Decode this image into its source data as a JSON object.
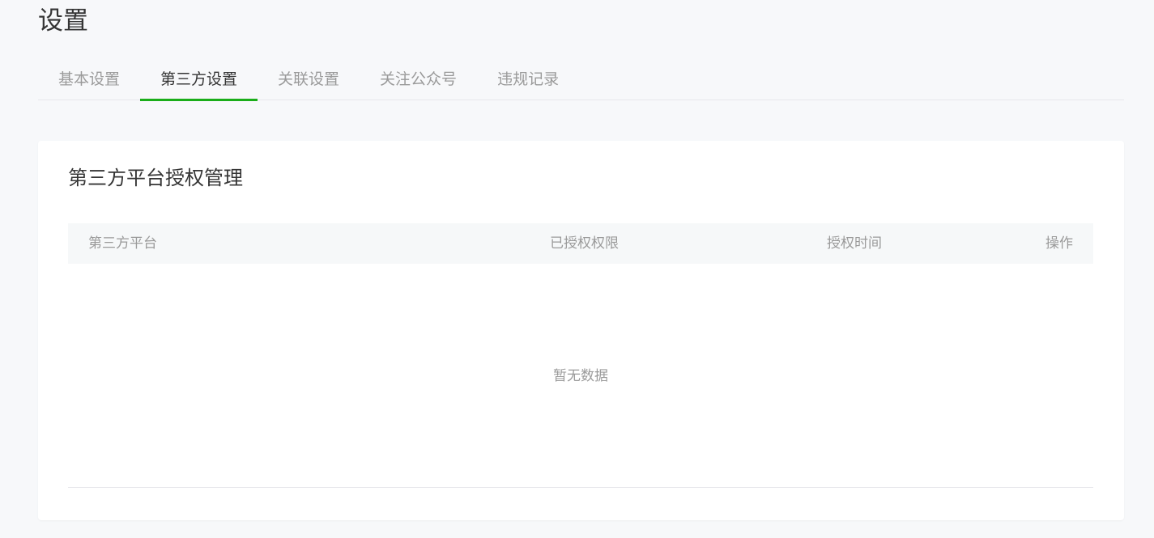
{
  "page": {
    "title": "设置"
  },
  "tabs": [
    {
      "label": "基本设置",
      "active": false
    },
    {
      "label": "第三方设置",
      "active": true
    },
    {
      "label": "关联设置",
      "active": false
    },
    {
      "label": "关注公众号",
      "active": false
    },
    {
      "label": "违规记录",
      "active": false
    }
  ],
  "card": {
    "title": "第三方平台授权管理",
    "table": {
      "columns": [
        "第三方平台",
        "已授权权限",
        "授权时间",
        "操作"
      ],
      "rows": [],
      "empty_text": "暂无数据"
    }
  },
  "colors": {
    "accent": "#1aad19",
    "text": "#353535",
    "muted": "#9a9a9a",
    "background": "#f7f8fa"
  }
}
